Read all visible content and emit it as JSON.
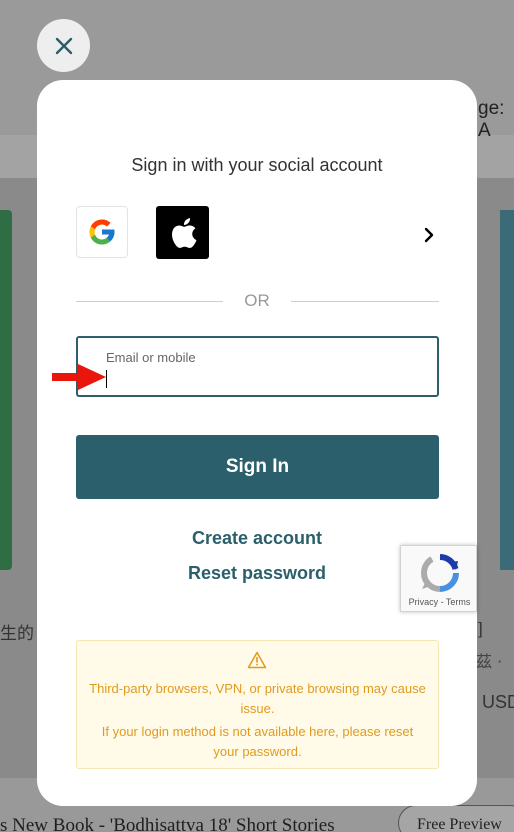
{
  "background": {
    "language_partial": "ge: A",
    "left_cjk_text": "生的 ",
    "right_bracket_text": "]",
    "right_cjk_text": "茲 ·",
    "currency_partial": "USD",
    "book_title_partial": "s New Book - 'Bodhisattva 18' Short Stories",
    "free_preview_label": "Free Preview"
  },
  "close_button": {
    "icon": "close-icon"
  },
  "modal": {
    "social_title": "Sign in with your social account",
    "social_providers": [
      "google-icon",
      "apple-icon"
    ],
    "or_text": "OR",
    "email": {
      "label": "Email or mobile",
      "value": "",
      "placeholder": ""
    },
    "sign_in_label": "Sign In",
    "create_account_label": "Create account",
    "reset_password_label": "Reset password",
    "notice": {
      "icon": "warning-icon",
      "line1": "Third-party browsers, VPN, or private browsing may cause issue.",
      "line2": "If your login method is not available here, please reset your password."
    }
  },
  "recaptcha": {
    "terms": "Privacy - Terms"
  },
  "colors": {
    "primary": "#2b5f6b",
    "notice_text": "#e09a1f",
    "notice_bg": "#fffbe8",
    "annotation_arrow": "#e8160c"
  }
}
